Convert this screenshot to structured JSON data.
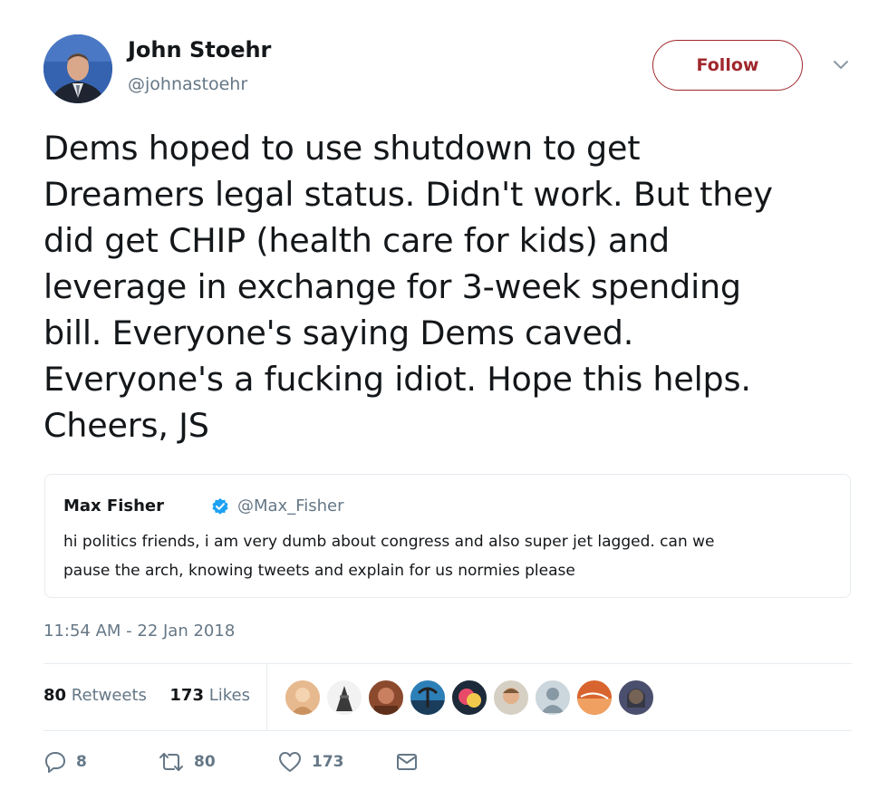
{
  "author": {
    "name": "John Stoehr",
    "handle": "@johnastoehr"
  },
  "follow_label": "Follow",
  "tweet_lines": [
    "Dems hoped to use shutdown to get",
    "Dreamers legal status. Didn't work. But they",
    "did get CHIP (health care for kids) and",
    "leverage in exchange for 3-week spending",
    "bill. Everyone's saying Dems caved.",
    "Everyone's a fucking idiot. Hope this helps.",
    "Cheers, JS"
  ],
  "quoted": {
    "name": "Max Fisher",
    "handle": "@Max_Fisher",
    "verified": true,
    "lines": [
      "hi politics friends, i am very dumb about congress and also super jet lagged. can we",
      "pause the arch, knowing tweets and explain for us normies please"
    ]
  },
  "timestamp": "11:54 AM - 22 Jan 2018",
  "stats": {
    "retweets_count": "80",
    "retweets_label": "Retweets",
    "likes_count": "173",
    "likes_label": "Likes"
  },
  "actions": {
    "reply_count": "8",
    "retweet_count": "80",
    "like_count": "173"
  },
  "colors": {
    "follow": "#a0282d",
    "secondary_text": "#657786",
    "verified": "#1da1f2",
    "divider": "#e6ecf0"
  },
  "icons": [
    "chevron-down-icon",
    "verified-badge-icon",
    "reply-icon",
    "retweet-icon",
    "heart-icon",
    "mail-icon"
  ]
}
